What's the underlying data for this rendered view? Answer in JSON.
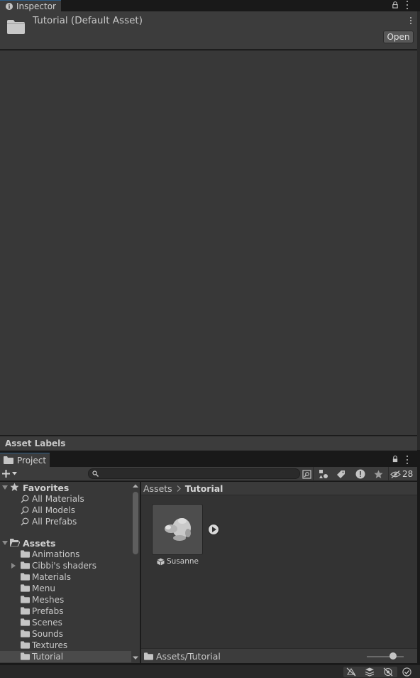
{
  "inspector": {
    "tab_label": "Inspector",
    "title": "Tutorial (Default Asset)",
    "open_label": "Open",
    "asset_labels": "Asset Labels"
  },
  "project": {
    "tab_label": "Project",
    "search": {
      "value": "",
      "placeholder": ""
    },
    "hidden_packages_count": "28",
    "favorites": {
      "label": "Favorites",
      "items": [
        {
          "label": "All Materials"
        },
        {
          "label": "All Models"
        },
        {
          "label": "All Prefabs"
        }
      ]
    },
    "assets": {
      "label": "Assets",
      "folders": [
        {
          "label": "Animations",
          "expandable": false
        },
        {
          "label": "Cibbi's shaders",
          "expandable": true
        },
        {
          "label": "Materials",
          "expandable": false
        },
        {
          "label": "Menu",
          "expandable": false
        },
        {
          "label": "Meshes",
          "expandable": false
        },
        {
          "label": "Prefabs",
          "expandable": false
        },
        {
          "label": "Scenes",
          "expandable": false
        },
        {
          "label": "Sounds",
          "expandable": false
        },
        {
          "label": "Textures",
          "expandable": false
        },
        {
          "label": "Tutorial",
          "expandable": false,
          "selected": true
        }
      ]
    },
    "breadcrumb": {
      "root": "Assets",
      "current": "Tutorial"
    },
    "assets_in_folder": [
      {
        "name": "Susanne",
        "type": "model"
      }
    ],
    "footer_path": "Assets/Tutorial"
  },
  "colors": {
    "panel": "#3c3c3c",
    "body": "#383838",
    "selection": "#4a4a4a",
    "tab_accent": "#2c5d87"
  }
}
